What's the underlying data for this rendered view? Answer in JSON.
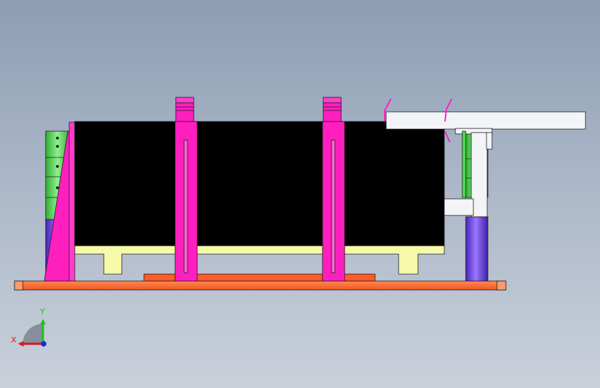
{
  "viewport": {
    "background_top": "#8d9db4",
    "background_bottom": "#c9d0da"
  },
  "model": {
    "colors": {
      "base_plate": "#ff6d3a",
      "magenta_part": "#ff1fbf",
      "black_block": "#000000",
      "yellow_tray": "#f6f9a8",
      "green_cylinder": "#4fdc52",
      "blue_cylinder": "#6b3fe0",
      "white_bracket": "#f3f4f7",
      "outline": "#1a1a1a"
    }
  },
  "triad": {
    "x_label": "X",
    "y_label": "Y",
    "x_color": "#e0121a",
    "y_color": "#18c21a",
    "z_color": "#1a2ae0"
  }
}
